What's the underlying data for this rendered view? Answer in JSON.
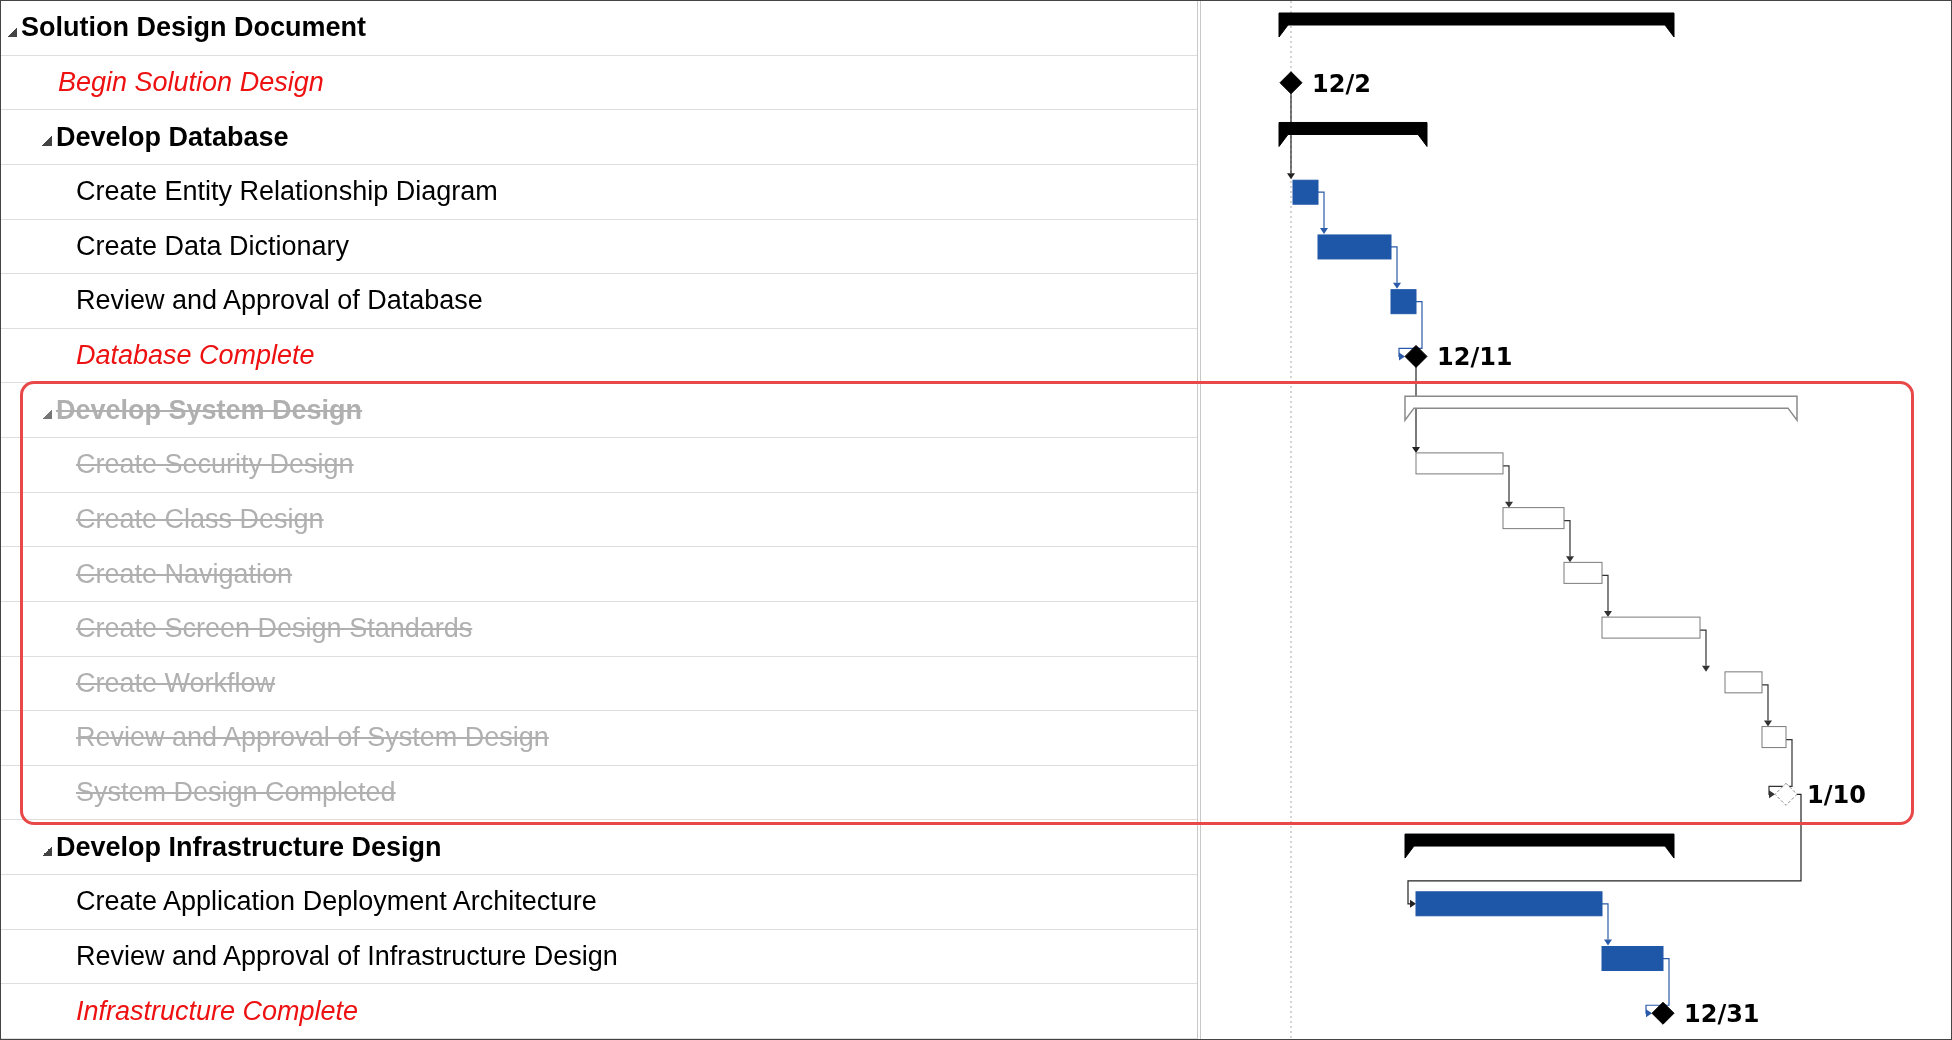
{
  "tasks": [
    {
      "name": "Solution Design Document",
      "kind": "summary",
      "expanded": true,
      "inactive": false,
      "children": [
        {
          "name": "Begin Solution Design",
          "kind": "milestone",
          "inactive": false,
          "date_label": "12/2"
        },
        {
          "name": "Develop Database",
          "kind": "summary",
          "expanded": true,
          "inactive": false,
          "children": [
            {
              "name": "Create Entity Relationship Diagram",
              "kind": "task",
              "inactive": false
            },
            {
              "name": "Create Data Dictionary",
              "kind": "task",
              "inactive": false
            },
            {
              "name": "Review and Approval of Database",
              "kind": "task",
              "inactive": false
            },
            {
              "name": "Database Complete",
              "kind": "milestone",
              "inactive": false,
              "date_label": "12/11"
            }
          ]
        },
        {
          "name": "Develop System Design",
          "kind": "summary",
          "expanded": true,
          "inactive": true,
          "children": [
            {
              "name": "Create Security Design",
              "kind": "task",
              "inactive": true
            },
            {
              "name": "Create Class Design",
              "kind": "task",
              "inactive": true
            },
            {
              "name": "Create Navigation",
              "kind": "task",
              "inactive": true
            },
            {
              "name": "Create Screen Design Standards",
              "kind": "task",
              "inactive": true
            },
            {
              "name": "Create Workflow",
              "kind": "task",
              "inactive": true
            },
            {
              "name": "Review and Approval of System Design",
              "kind": "task",
              "inactive": true
            },
            {
              "name": "System Design Completed",
              "kind": "milestone",
              "inactive": true,
              "date_label": "1/10"
            }
          ]
        },
        {
          "name": "Develop Infrastructure Design",
          "kind": "summary",
          "expanded": true,
          "inactive": false,
          "children": [
            {
              "name": "Create Application Deployment Architecture",
              "kind": "task",
              "inactive": false
            },
            {
              "name": "Review and Approval of Infrastructure Design",
              "kind": "task",
              "inactive": false
            },
            {
              "name": "Infrastructure Complete",
              "kind": "milestone",
              "inactive": false,
              "date_label": "12/31"
            }
          ]
        }
      ]
    }
  ]
}
